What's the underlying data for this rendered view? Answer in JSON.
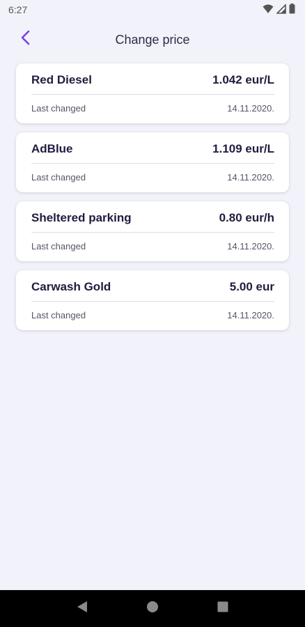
{
  "status_bar": {
    "time": "6:27",
    "icons": [
      "wifi-icon",
      "signal-icon",
      "battery-icon"
    ]
  },
  "header": {
    "back_icon": "chevron-left-icon",
    "title": "Change price"
  },
  "colors": {
    "accent": "#7b3fe4",
    "background": "#f2f3fa",
    "card": "#ffffff",
    "text": "#1f1d3f"
  },
  "items": [
    {
      "name": "Red Diesel",
      "price": "1.042 eur/L",
      "label": "Last changed",
      "date": "14.11.2020."
    },
    {
      "name": "AdBlue",
      "price": "1.109 eur/L",
      "label": "Last changed",
      "date": "14.11.2020."
    },
    {
      "name": "Sheltered parking",
      "price": "0.80 eur/h",
      "label": "Last changed",
      "date": "14.11.2020."
    },
    {
      "name": "Carwash Gold",
      "price": "5.00 eur",
      "label": "Last changed",
      "date": "14.11.2020."
    }
  ],
  "nav_bar": {
    "icons": [
      "back-triangle-icon",
      "home-circle-icon",
      "recents-square-icon"
    ]
  }
}
